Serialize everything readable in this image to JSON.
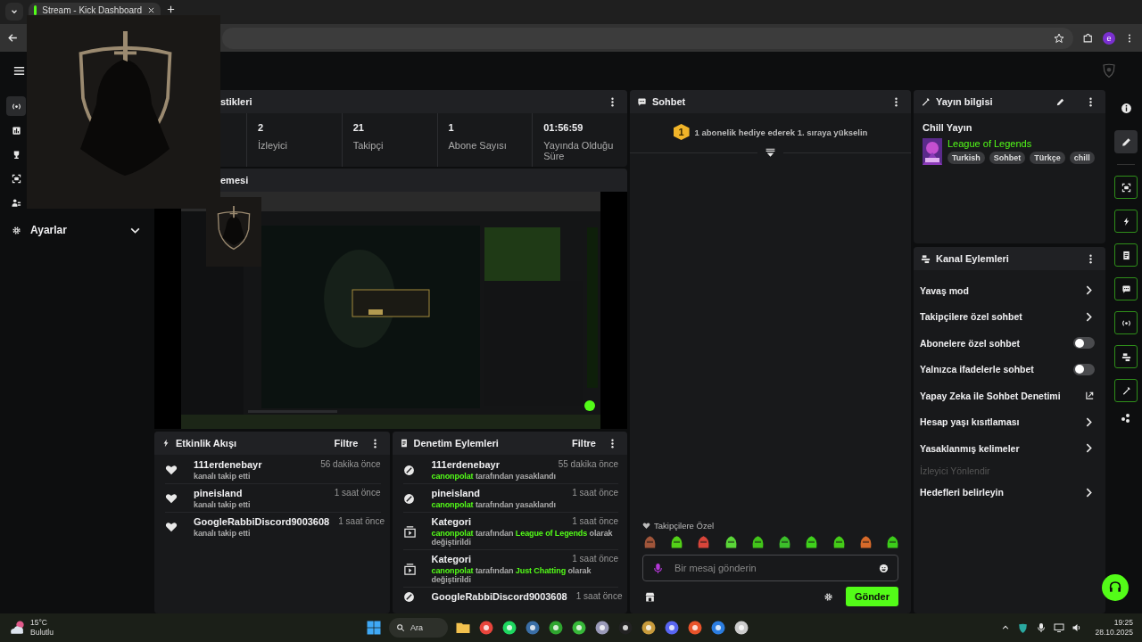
{
  "browser": {
    "tab_title": "Stream - Kick Dashboard",
    "profile_initial": "e"
  },
  "sidebar": {
    "icons": [
      {
        "kind": "broadcast",
        "selected": true
      },
      {
        "kind": "chart",
        "selected": false
      },
      {
        "kind": "trophy",
        "selected": false
      },
      {
        "kind": "screen",
        "selected": false
      },
      {
        "kind": "users",
        "selected": false
      }
    ],
    "settings": "Ayarlar"
  },
  "stats": {
    "title": "stikleri",
    "items": [
      {
        "value": "2",
        "label": "İzleyici"
      },
      {
        "value": "21",
        "label": "Takipçi"
      },
      {
        "value": "1",
        "label": "Abone Sayısı"
      },
      {
        "value": "01:56:59",
        "label": "Yayında Olduğu Süre"
      }
    ]
  },
  "preview": {
    "title": "emesi"
  },
  "events": {
    "title": "Etkinlik Akışı",
    "filter": "Filtre",
    "items": [
      {
        "user": "111erdenebayr",
        "text": "kanalı takip etti",
        "time": "56 dakika önce"
      },
      {
        "user": "pineisland",
        "text": "kanalı takip etti",
        "time": "1 saat önce"
      },
      {
        "user": "GoogleRabbiDiscord9003608",
        "text": "kanalı takip etti",
        "time": "1 saat önce"
      }
    ]
  },
  "moderation": {
    "title": "Denetim Eylemleri",
    "filter": "Filtre",
    "items": [
      {
        "kind": "ban",
        "title": "111erdenebayr",
        "text": "**canonpolat** tarafından yasaklandı",
        "time": "55 dakika önce"
      },
      {
        "kind": "ban",
        "title": "pineisland",
        "text": "**canonpolat** tarafından yasaklandı",
        "time": "1 saat önce"
      },
      {
        "kind": "category",
        "title": "Kategori",
        "text": "**canonpolat** tarafından **League of Legends**  olarak değiştirildi",
        "time": "1 saat önce"
      },
      {
        "kind": "category",
        "title": "Kategori",
        "text": "**canonpolat** tarafından **Just Chatting** olarak değiştirildi",
        "time": "1 saat önce"
      },
      {
        "kind": "ban",
        "title": "GoogleRabbiDiscord9003608",
        "time": "1 saat önce"
      }
    ]
  },
  "chat": {
    "title": "Sohbet",
    "banner": {
      "badge": "1",
      "text": "1 abonelik hediye ederek 1. sıraya yükselin"
    },
    "emote_label": "Takipçilere Özel",
    "input": {
      "placeholder": "Bir mesaj gönderin"
    },
    "send": "Gönder"
  },
  "stream_info": {
    "title": "Yayın bilgisi",
    "stream_title": "Chill Yayın",
    "category": "League of Legends",
    "tags": [
      "Turkish",
      "Sohbet",
      "Türkçe",
      "chill"
    ]
  },
  "channel_actions": {
    "title": "Kanal Eylemleri",
    "items": [
      {
        "kind": "link",
        "label": "Yavaş mod"
      },
      {
        "kind": "link",
        "label": "Takipçilere özel sohbet"
      },
      {
        "kind": "toggle",
        "label": "Abonelere özel sohbet",
        "on": false
      },
      {
        "kind": "toggle",
        "label": "Yalnızca ifadelerle sohbet",
        "on": false
      },
      {
        "kind": "external",
        "label": "Yapay Zeka ile Sohbet Denetimi"
      },
      {
        "kind": "link",
        "label": "Hesap yaşı kısıtlaması"
      },
      {
        "kind": "link",
        "label": "Yasaklanmış kelimeler"
      },
      {
        "kind": "section",
        "label": "İzleyici Yönlendir"
      },
      {
        "kind": "link",
        "label": "Hedefleri belirleyin"
      }
    ]
  },
  "rail": [
    {
      "kind": "info",
      "selected": false
    },
    {
      "kind": "edit",
      "selected": true
    }
  ],
  "taskbar": {
    "weather": {
      "temp": "15°C",
      "condition": "Bulutlu"
    },
    "search": "Ara",
    "time": "19:25",
    "date": "28.10.2025"
  }
}
